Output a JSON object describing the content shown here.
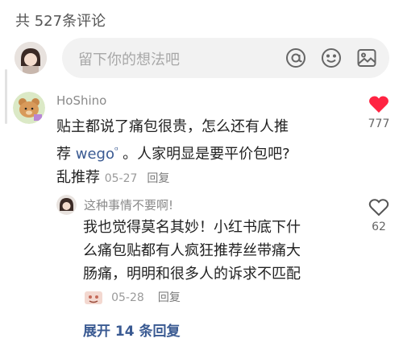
{
  "header": {
    "comment_count_text": "共 527条评论"
  },
  "composer": {
    "placeholder": "留下你的想法吧",
    "icons": [
      "at-icon",
      "emoji-icon",
      "image-icon"
    ]
  },
  "comments": [
    {
      "author": "HoShino",
      "text_line1": "贴主都说了痛包很贵，怎么还有人推",
      "text_line2_pre": "荐 ",
      "link_text": "wego",
      "link_icon": "ᵅ",
      "text_line2_post": " 。人家明显是要平价包吧?",
      "text_line3": "乱推荐",
      "date": "05-27",
      "reply_label": "回复",
      "likes": "777",
      "liked": true
    }
  ],
  "replies": [
    {
      "author": "这种事情不要啊!",
      "line1": "我也觉得莫名其妙！小红书底下什",
      "line2": "么痛包贴都有人疯狂推荐丝带痛大",
      "line3": "肠痛，明明和很多人的诉求不匹配",
      "date": "05-28",
      "reply_label": "回复",
      "likes": "62",
      "liked": false
    }
  ],
  "expand_label": "展开 14 条回复",
  "colors": {
    "like_active": "#ff2442",
    "link": "#3a5a92"
  }
}
